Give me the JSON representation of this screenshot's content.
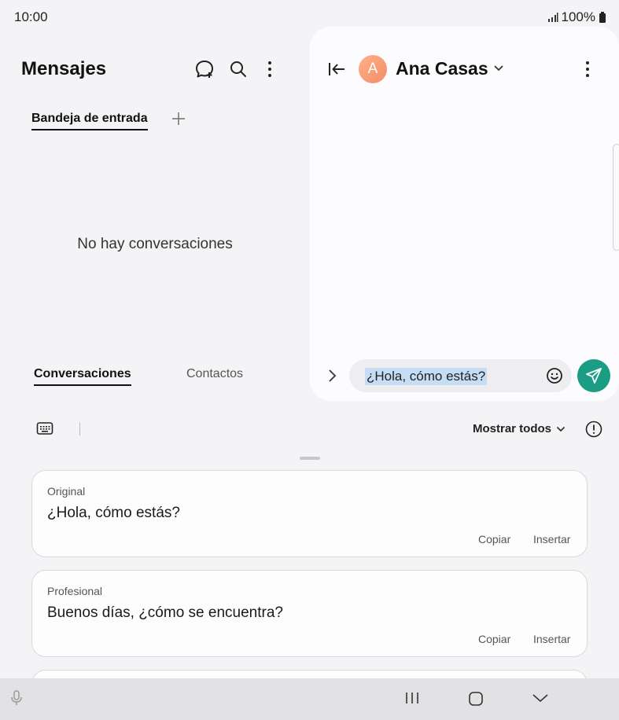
{
  "status": {
    "time": "10:00",
    "battery": "100%"
  },
  "left_pane": {
    "title": "Mensajes",
    "tab_inbox": "Bandeja de entrada",
    "empty_message": "No hay conversaciones",
    "bottom_tabs": {
      "conversations": "Conversaciones",
      "contacts": "Contactos"
    }
  },
  "conversation": {
    "avatar_letter": "A",
    "contact_name": "Ana Casas",
    "compose_text": "¿Hola, cómo estás?"
  },
  "toolbar": {
    "show_all": "Mostrar todos"
  },
  "suggestions": [
    {
      "label": "Original",
      "text": "¿Hola, cómo estás?",
      "copy": "Copiar",
      "insert": "Insertar"
    },
    {
      "label": "Profesional",
      "text": "Buenos días, ¿cómo se encuentra?",
      "copy": "Copiar",
      "insert": "Insertar"
    }
  ],
  "colors": {
    "accent": "#1a9d82",
    "avatar": "#f5a07a",
    "selection": "#c6ddf6"
  }
}
